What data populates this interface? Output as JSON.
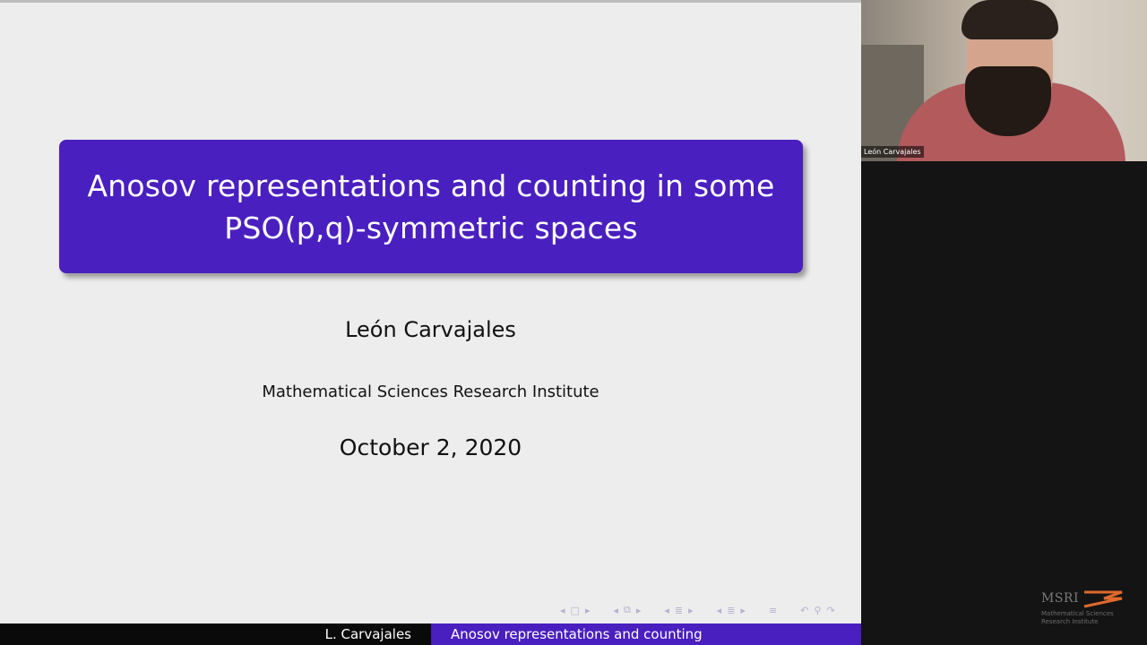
{
  "slide": {
    "title_line1": "Anosov representations and counting in some",
    "title_line2": "PSO(p,q)-symmetric spaces",
    "author": "León Carvajales",
    "institute": "Mathematical Sciences Research Institute",
    "date": "October 2, 2020",
    "title_box_color": "#4a1fbf",
    "background_color": "#ededed"
  },
  "footer": {
    "left": "L. Carvajales",
    "right": "Anosov representations and counting",
    "left_color": "#0a0a0a",
    "right_color": "#4a1fbf"
  },
  "navbar": {
    "icons": [
      "prev-arrow-icon",
      "frame-icon",
      "next-arrow-icon",
      "prev-arrow-icon",
      "frames-stack-icon",
      "next-arrow-icon",
      "prev-arrow-icon",
      "section-icon",
      "next-arrow-icon",
      "prev-arrow-icon",
      "subsection-icon",
      "next-arrow-icon",
      "toc-icon",
      "undo-icon",
      "search-icon",
      "redo-icon"
    ]
  },
  "video": {
    "participant_name": "León Carvajales"
  },
  "logo": {
    "word": "MSRI",
    "line1": "Mathematical Sciences",
    "line2": "Research Institute",
    "accent": "#e06a2c"
  }
}
